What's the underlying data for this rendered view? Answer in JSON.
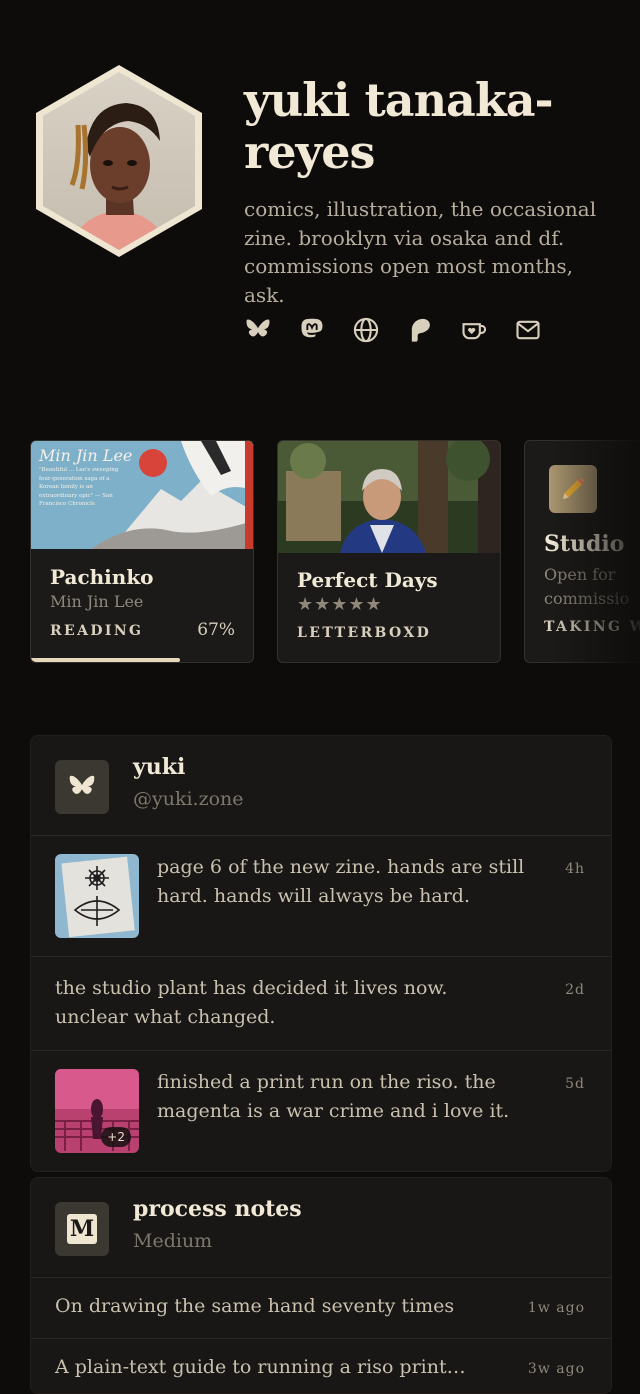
{
  "profile": {
    "name": "yuki tanaka-reyes",
    "bio": "comics, illustration, the occasional zine. brooklyn via osaka and df. commissions open most months, ask.",
    "socials": [
      {
        "icon": "bluesky-icon"
      },
      {
        "icon": "mastodon-icon"
      },
      {
        "icon": "globe-icon"
      },
      {
        "icon": "patreon-icon"
      },
      {
        "icon": "kofi-icon"
      },
      {
        "icon": "mail-icon"
      }
    ]
  },
  "cards": [
    {
      "cover_author": "Min Jin Lee",
      "cover_blurb": "\"Beautiful ... Lee's sweeping four-generation saga of a Korean family is an extraordinary epic\" — San Francisco Chronicle",
      "title": "Pachinko",
      "subtitle": "Min Jin Lee",
      "tag": "READING",
      "percent_label": "67%",
      "progress": 0.67
    },
    {
      "title": "Perfect Days",
      "stars": "★★★★★",
      "rating": 5,
      "tag": "LETTERBOXD"
    },
    {
      "icon": "pencil-icon",
      "title": "Studio",
      "subtitle": "Open for commissio",
      "tag": "TAKING W"
    }
  ],
  "bluesky": {
    "icon": "bluesky-icon",
    "name": "yuki",
    "handle": "@yuki.zone",
    "posts": [
      {
        "text": "page 6 of the new zine. hands are still hard. hands will always be hard.",
        "time": "4h"
      },
      {
        "text": "the studio plant has decided it lives now. unclear what changed.",
        "time": "2d"
      },
      {
        "text": "finished a print run on the riso. the magenta is a war crime and i love it.",
        "time": "5d",
        "more": "+2"
      }
    ]
  },
  "medium": {
    "icon_letter": "M",
    "name": "process notes",
    "platform": "Medium",
    "articles": [
      {
        "title": "On drawing the same hand seventy times",
        "ago": "1w ago"
      },
      {
        "title": "A plain-text guide to running a riso print…",
        "ago": "3w ago"
      }
    ]
  },
  "colors": {
    "background": "#0d0c0b",
    "card": "#1b1a18",
    "accent_cream": "#e5d8bb",
    "text_muted": "#8f877a"
  }
}
